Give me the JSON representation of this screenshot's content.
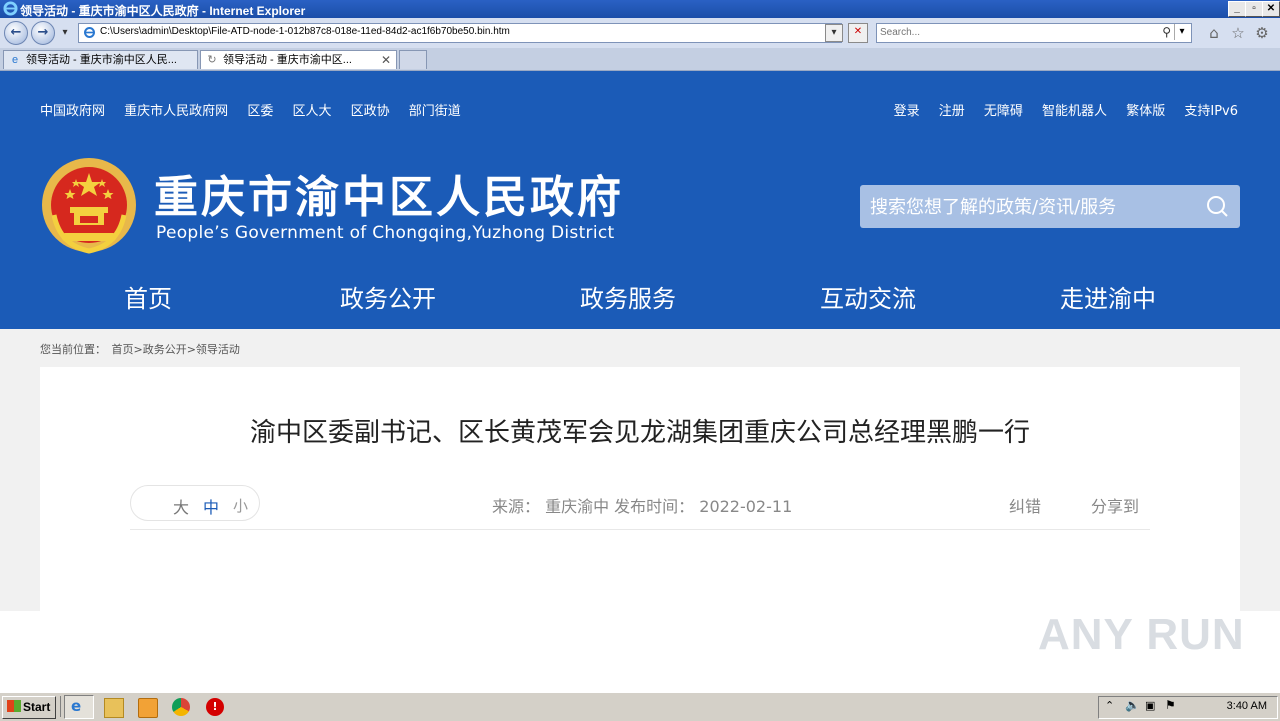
{
  "window": {
    "title": "领导活动 - 重庆市渝中区人民政府 - Internet Explorer",
    "address": "C:\\Users\\admin\\Desktop\\File-ATD-node-1-012b87c8-018e-11ed-84d2-ac1f6b70be50.bin.htm",
    "search_placeholder": "Search...",
    "tabs": [
      {
        "label": "领导活动 - 重庆市渝中区人民..."
      },
      {
        "label": "领导活动 - 重庆市渝中区..."
      }
    ]
  },
  "site": {
    "top_links_left": [
      "中国政府网",
      "重庆市人民政府网",
      "区委",
      "区人大",
      "区政协",
      "部门街道"
    ],
    "top_links_right": [
      "登录",
      "注册",
      "无障碍",
      "智能机器人",
      "繁体版",
      "支持IPv6"
    ],
    "title": "重庆市渝中区人民政府",
    "subtitle": "People’s Government of Chongqing,Yuzhong District",
    "search_placeholder": "搜索您想了解的政策/资讯/服务",
    "nav": [
      "首页",
      "政务公开",
      "政务服务",
      "互动交流",
      "走进渝中"
    ],
    "header_color": "#1b5bb7"
  },
  "breadcrumb": {
    "prefix": "您当前位置：",
    "path": "首页>政务公开>领导活动"
  },
  "article": {
    "title": "渝中区委副书记、区长黄茂军会见龙湖集团重庆公司总经理黑鹏一行",
    "font_sizes": [
      "大",
      "中",
      "小"
    ],
    "meta": "来源： 重庆渝中 发布时间： 2022-02-11",
    "report_label": "纠错",
    "share_label": "分享到"
  },
  "watermark": "ANY RUN",
  "taskbar": {
    "start_label": "Start",
    "clock": "3:40 AM"
  }
}
